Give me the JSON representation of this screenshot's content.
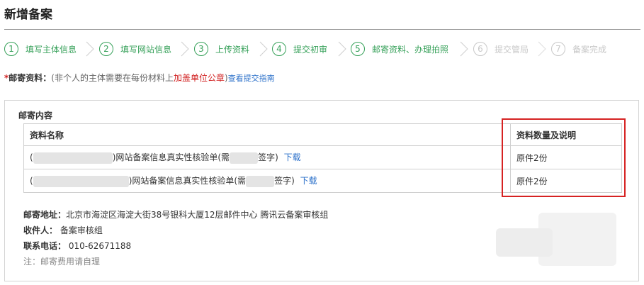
{
  "page": {
    "title": "新增备案"
  },
  "steps": [
    {
      "num": "1",
      "label": "填写主体信息",
      "state": "active"
    },
    {
      "num": "2",
      "label": "填写网站信息",
      "state": "active"
    },
    {
      "num": "3",
      "label": "上传资料",
      "state": "active"
    },
    {
      "num": "4",
      "label": "提交初审",
      "state": "active"
    },
    {
      "num": "5",
      "label": "邮寄资料、办理拍照",
      "state": "active"
    },
    {
      "num": "6",
      "label": "提交管局",
      "state": "inactive"
    },
    {
      "num": "7",
      "label": "备案完成",
      "state": "inactive"
    }
  ],
  "mail": {
    "required_mark": "*",
    "label": "邮寄资料：",
    "note_before": "(非个人的主体需要在每份材料上",
    "note_highlight": "加盖单位公章",
    "note_after": ")",
    "guide_link": "查看提交指南"
  },
  "contents": {
    "title": "邮寄内容",
    "headers": {
      "name": "资料名称",
      "count": "资料数量及说明"
    },
    "rows": [
      {
        "prefix": "(",
        "suffix": ")网站备案信息真实性核验单(需",
        "end": "签字)",
        "download": "下载",
        "count": "原件2份"
      },
      {
        "prefix": "(",
        "suffix": ")网站备案信息真实性核验单(需",
        "end": "签字)",
        "download": "下载",
        "count": "原件2份"
      }
    ]
  },
  "address": {
    "address_label": "邮寄地址：",
    "address_value": "北京市海淀区海淀大街38号银科大厦12层邮件中心 腾讯云备案审核组",
    "recipient_label": "收件人：",
    "recipient_value": "备案审核组",
    "phone_label": "联系电话：",
    "phone_value": "010-62671188",
    "note": "注：邮寄费用请自理"
  },
  "colors": {
    "accent": "#37a15a",
    "inactive": "#c8c8c8",
    "highlight": "#d12020",
    "link": "#2a6fc9",
    "box": "#d62222"
  }
}
